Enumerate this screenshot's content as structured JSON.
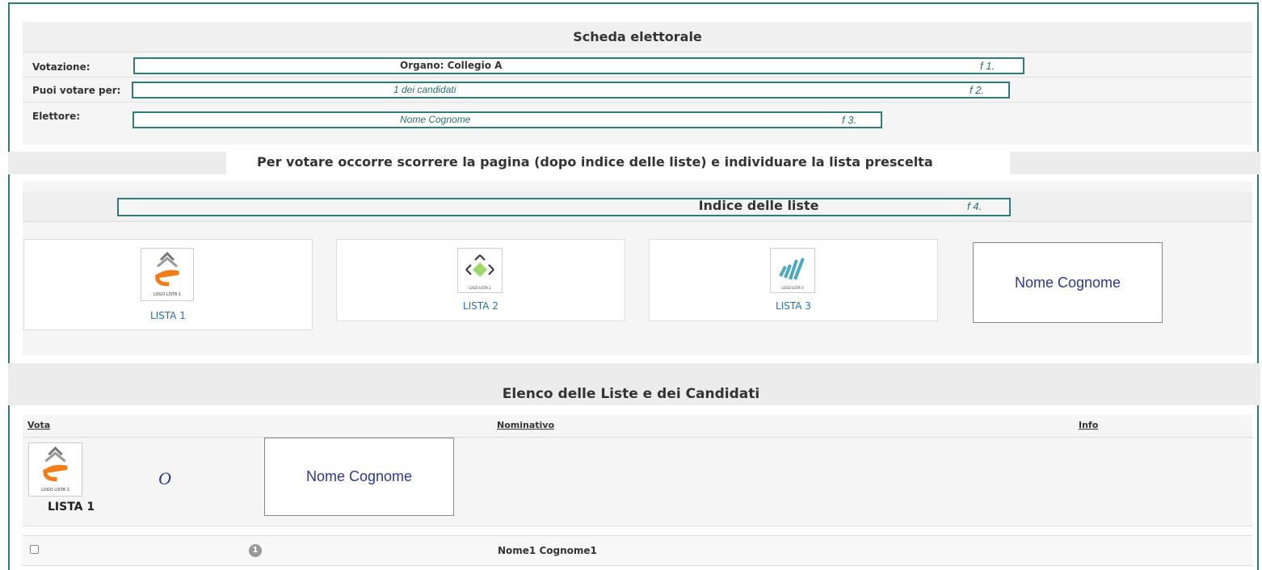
{
  "scheda": {
    "title": "Scheda elettorale",
    "votazione_label": "Votazione:",
    "votazione_value": "Organo: Collegio A",
    "votazione_ref": "f 1.",
    "puoi_label": "Puoi votare per:",
    "puoi_value": "1 dei candidati",
    "puoi_ref": "f 2.",
    "elettore_label": "Elettore:",
    "elettore_value": "Nome Cognome",
    "elettore_ref": "f 3."
  },
  "instruction": "Per votare occorre scorrere la pagina (dopo indice delle liste) e individuare la lista prescelta",
  "indice": {
    "title": "Indice delle liste",
    "ref": "f 4.",
    "lists": [
      {
        "label": "LISTA 1",
        "logo_text": "LOGO LISTA 1",
        "icon": "logo-lista-1-icon"
      },
      {
        "label": "LISTA 2",
        "logo_text": "LOGO LISTA 2",
        "icon": "logo-lista-2-icon"
      },
      {
        "label": "LISTA 3",
        "logo_text": "LOGO LISTA 3",
        "icon": "logo-lista-3-icon"
      }
    ],
    "name_card": "Nome Cognome"
  },
  "elenco": {
    "title": "Elenco delle Liste e dei Candidati",
    "col_vota": "Vota",
    "col_nominativo": "Nominativo",
    "col_info": "Info",
    "lista_label": "LISTA 1",
    "lista_logo_text": "LOGO LISTA 1",
    "circle_mark": "O",
    "name_card": "Nome Cognome",
    "candidates": [
      {
        "number": "1",
        "name": "Nome1 Cognome1"
      }
    ]
  },
  "colors": {
    "highlight_border": "#2e7d7a",
    "annotation_text": "#2a6f6b",
    "name_card_text": "#2b3990",
    "list_link": "#2a6fa8"
  }
}
